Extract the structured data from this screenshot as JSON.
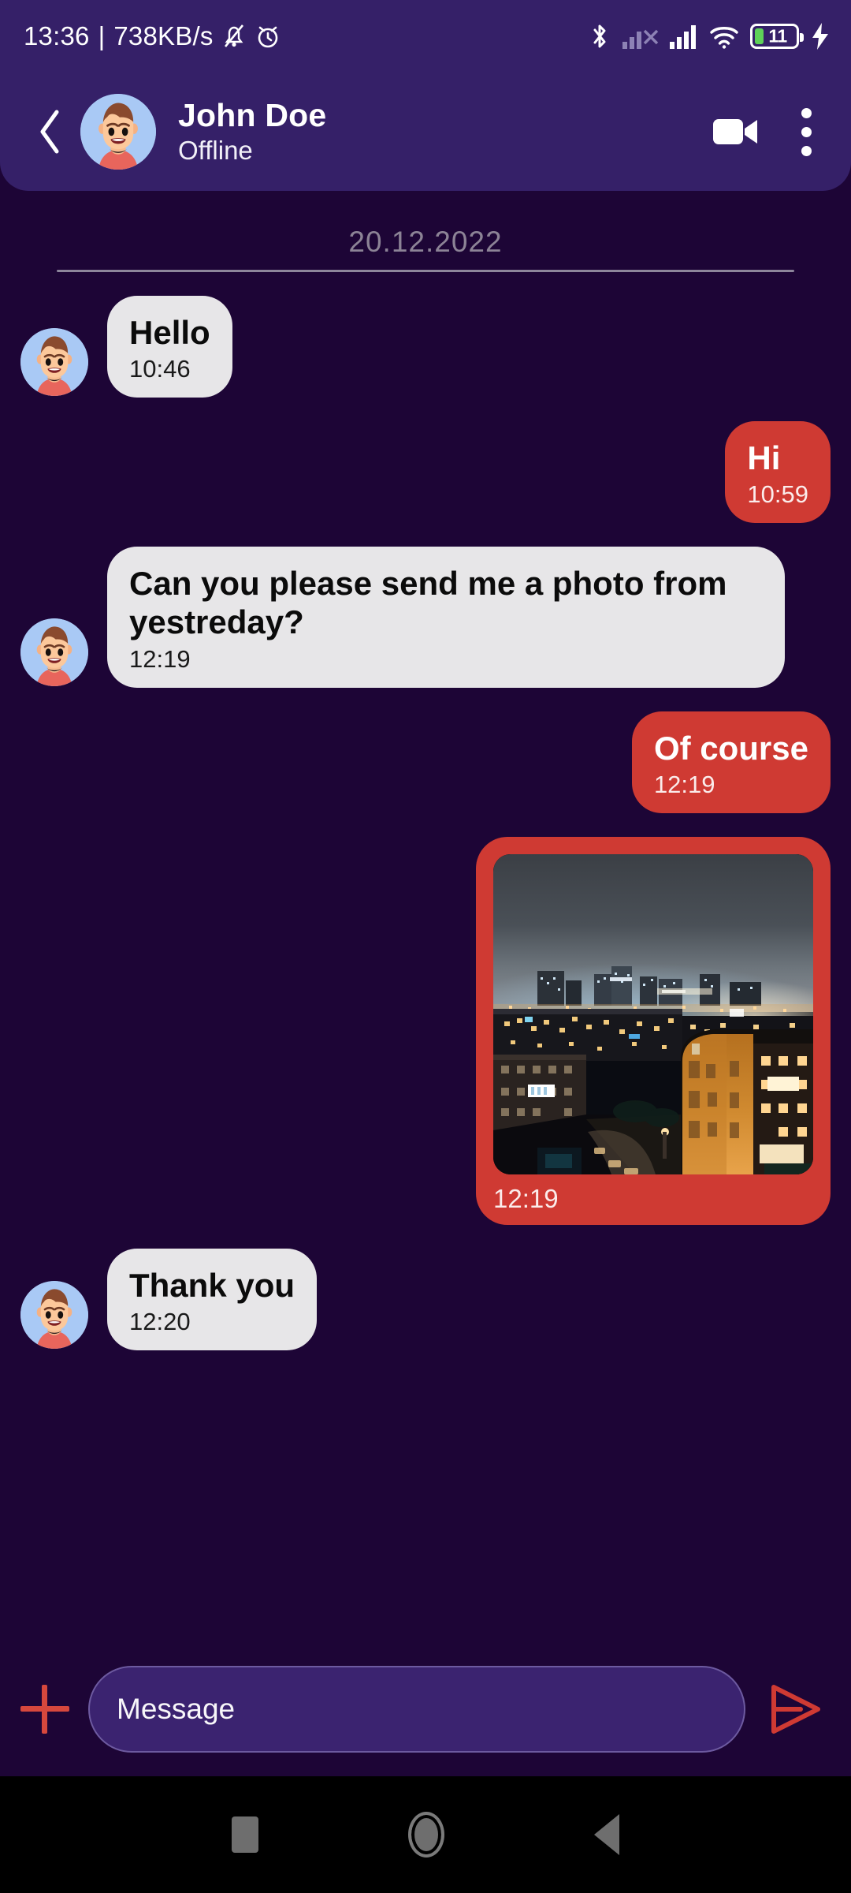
{
  "status_bar": {
    "time": "13:36",
    "separator": "|",
    "network_speed": "738KB/s",
    "icons": [
      "bell-muted-icon",
      "alarm-icon",
      "bluetooth-icon",
      "signal-no-sim-icon",
      "signal-bars-icon",
      "wifi-icon",
      "battery-icon",
      "charging-bolt-icon"
    ],
    "battery_level": "11"
  },
  "app_bar": {
    "back_icon": "back-chevron-icon",
    "avatar_icon": "contact-avatar",
    "name": "John Doe",
    "presence": "Offline",
    "video_call_icon": "video-camera-icon",
    "menu_icon": "overflow-menu-icon"
  },
  "conversation": {
    "date_divider": "20.12.2022",
    "messages": [
      {
        "id": "m1",
        "direction": "in",
        "type": "text",
        "text": "Hello",
        "time": "10:46",
        "show_avatar": true
      },
      {
        "id": "m2",
        "direction": "out",
        "type": "text",
        "text": "Hi",
        "time": "10:59",
        "show_avatar": false
      },
      {
        "id": "m3",
        "direction": "in",
        "type": "text",
        "text": "Can you please send me a photo from yestreday?",
        "time": "12:19",
        "show_avatar": true
      },
      {
        "id": "m4",
        "direction": "out",
        "type": "text",
        "text": "Of course",
        "time": "12:19",
        "show_avatar": false
      },
      {
        "id": "m5",
        "direction": "out",
        "type": "photo",
        "text": "",
        "time": "12:19",
        "show_avatar": false,
        "photo_alt": "night city skyline photo"
      },
      {
        "id": "m6",
        "direction": "in",
        "type": "text",
        "text": "Thank you",
        "time": "12:20",
        "show_avatar": true
      }
    ]
  },
  "composer": {
    "attach_icon": "plus-icon",
    "placeholder": "Message",
    "value": "",
    "send_icon": "send-icon"
  },
  "nav_bar": {
    "recents_icon": "recents-square-icon",
    "home_icon": "home-circle-icon",
    "back_icon": "back-triangle-icon"
  },
  "colors": {
    "status_bar_bg": "#352068",
    "app_bar_bg": "#352068",
    "chat_bg": "#1d0536",
    "incoming_bubble": "#e7e6e8",
    "outgoing_bubble": "#cf3a33",
    "accent_red": "#d6483d",
    "input_bg": "#3b2370",
    "nav_bar_bg": "#000000",
    "battery_green": "#5fd158"
  }
}
